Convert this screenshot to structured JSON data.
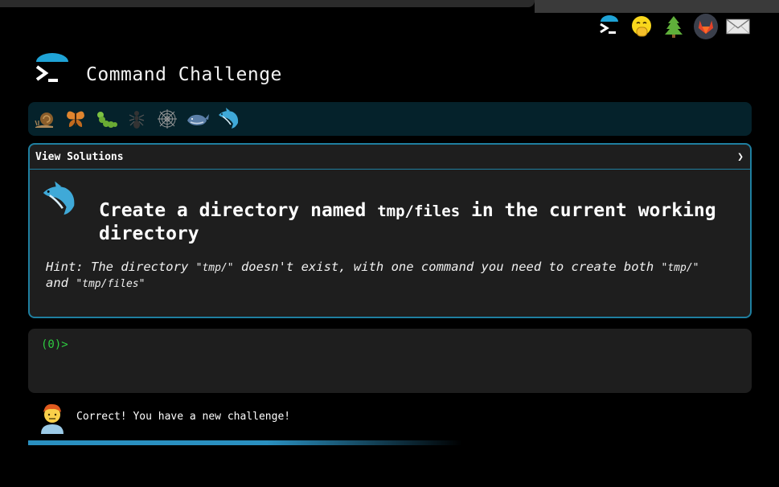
{
  "header": {
    "title": "Command Challenge",
    "top_icons": [
      "terminal-logo-icon",
      "hand-over-mouth-emoji-icon",
      "tree-icon",
      "gitlab-icon",
      "mail-icon"
    ]
  },
  "levels": {
    "icons": [
      "snail-icon",
      "butterfly-icon",
      "caterpillar-icon",
      "ant-icon",
      "spider-web-icon",
      "whale-icon",
      "dolphin-icon"
    ]
  },
  "challenge": {
    "view_solutions_label": "View Solutions",
    "chevron": "❯",
    "title_prefix": "Create a directory named ",
    "title_code": "tmp/files",
    "title_suffix": " in the current working directory",
    "hint_1": "Hint: The directory ",
    "hint_q1": "\"tmp/\"",
    "hint_2": " doesn't exist, with one command you need to create both ",
    "hint_q2": "\"tmp/\"",
    "hint_3": " and ",
    "hint_q3": "\"tmp/files\""
  },
  "terminal": {
    "prompt": "(0)>"
  },
  "status": {
    "message": "Correct! You have a new challenge!",
    "progress": 0.6
  },
  "colors": {
    "accent": "#1f7fa0",
    "prompt_green": "#2ecc40",
    "level_bar_bg": "#05222b"
  }
}
